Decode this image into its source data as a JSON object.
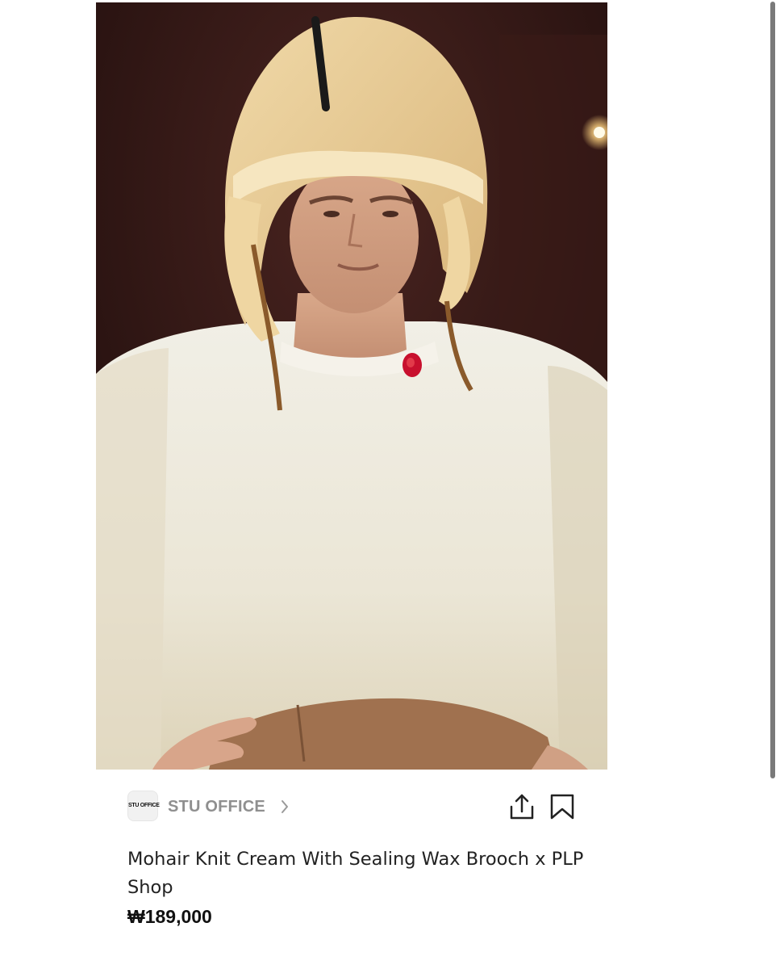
{
  "product": {
    "image_alt": "",
    "brand": {
      "logo_text": "STU OFFICE",
      "name": "STU OFFICE",
      "chevron_icon": "chevron-right-icon"
    },
    "actions": {
      "share_icon": "share-icon",
      "bookmark_icon": "bookmark-icon"
    },
    "title": "Mohair Knit Cream With Sealing Wax Brooch x PLP Shop",
    "price": "₩189,000"
  },
  "colors": {
    "brand_gray": "#8f8f8f",
    "price_text": "#111111",
    "brooch_red": "#c8102e"
  }
}
